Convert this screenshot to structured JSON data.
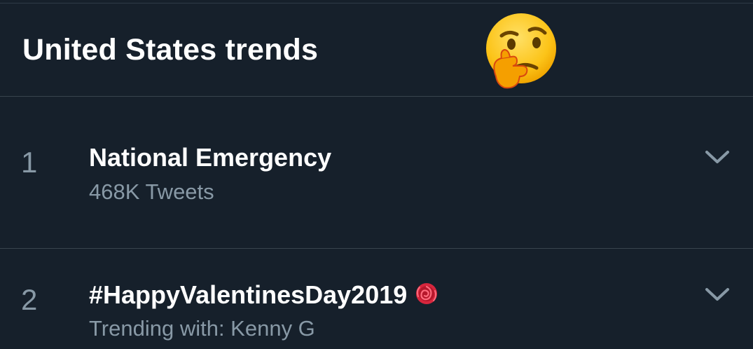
{
  "header": {
    "title": "United States trends",
    "emoji_icon": "thinking-face-emoji"
  },
  "trends": [
    {
      "rank": "1",
      "name": "National Emergency",
      "meta": "468K Tweets",
      "menu_icon": "chevron-down-icon"
    },
    {
      "rank": "2",
      "name": "#HappyValentinesDay2019",
      "name_emoji": "rose-icon",
      "meta": "Trending with: Kenny G",
      "menu_icon": "chevron-down-icon"
    }
  ],
  "colors": {
    "background": "#16202b",
    "divider": "#38444d",
    "primary_text": "#ffffff",
    "secondary_text": "#8899a6"
  }
}
